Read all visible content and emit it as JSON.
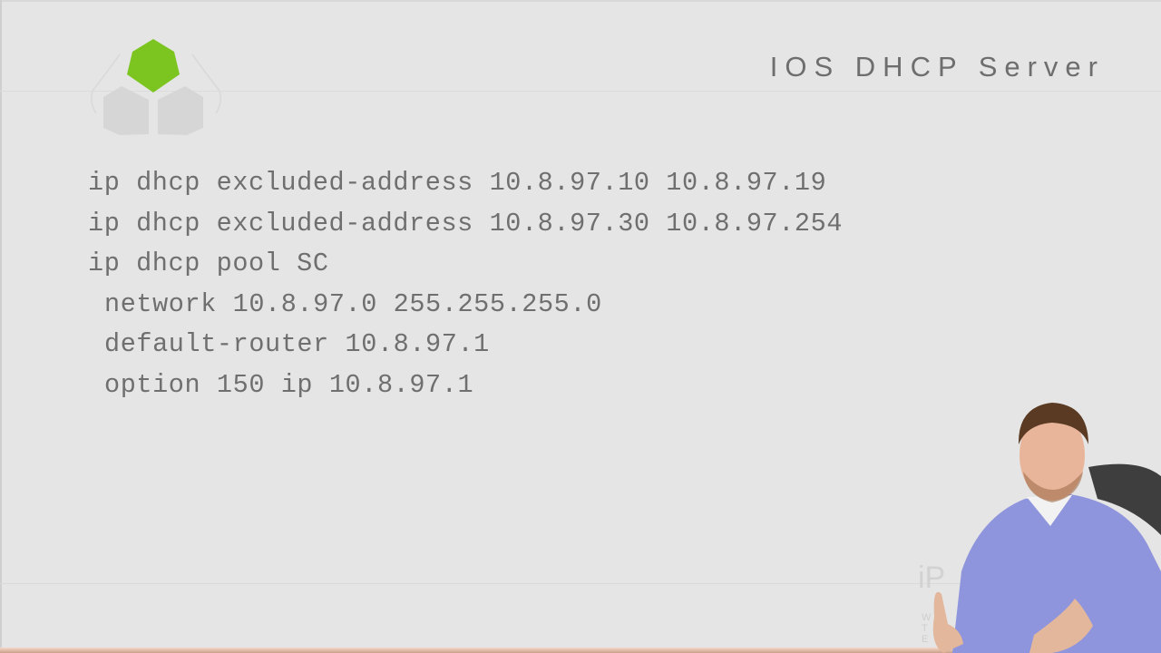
{
  "slide": {
    "title": "IOS DHCP Server",
    "code_lines": [
      {
        "text": "ip dhcp excluded-address 10.8.97.10 10.8.97.19",
        "indent": false
      },
      {
        "text": "ip dhcp excluded-address 10.8.97.30 10.8.97.254",
        "indent": false
      },
      {
        "text": "ip dhcp pool SC",
        "indent": false
      },
      {
        "text": "network 10.8.97.0 255.255.255.0",
        "indent": true
      },
      {
        "text": "default-router 10.8.97.1",
        "indent": true
      },
      {
        "text": "option 150 ip 10.8.97.1",
        "indent": true
      }
    ]
  },
  "logo": {
    "icon": "hexagon-logo-icon",
    "accent_color": "#7cc520",
    "secondary_color": "#d6d6d6"
  },
  "watermark": {
    "text": "iP",
    "sub": "W\nT\nE"
  },
  "presenter": {
    "icon": "presenter-video-overlay"
  }
}
